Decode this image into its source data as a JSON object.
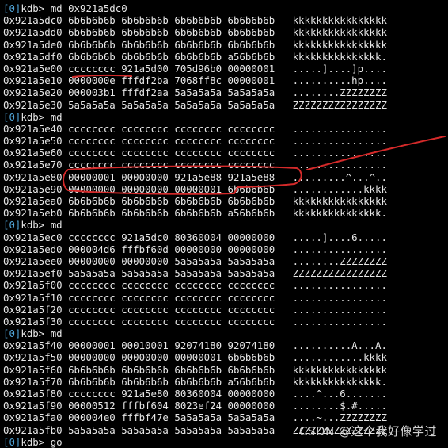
{
  "colors": {
    "background": "#000000",
    "text": "#e6e6e6",
    "prompt_tag": "#4fa3d6",
    "annotation": "#d42a2a"
  },
  "terminal": {
    "lines": [
      {
        "kind": "prompt",
        "tag": "[0]",
        "text": "kdb> md 0x921a5dc0"
      },
      {
        "kind": "dump",
        "addr": "0x921a5dc0",
        "words": "6b6b6b6b 6b6b6b6b 6b6b6b6b 6b6b6b6b",
        "ascii": "kkkkkkkkkkkkkkkk"
      },
      {
        "kind": "dump",
        "addr": "0x921a5dd0",
        "words": "6b6b6b6b 6b6b6b6b 6b6b6b6b 6b6b6b6b",
        "ascii": "kkkkkkkkkkkkkkkk"
      },
      {
        "kind": "dump",
        "addr": "0x921a5de0",
        "words": "6b6b6b6b 6b6b6b6b 6b6b6b6b 6b6b6b6b",
        "ascii": "kkkkkkkkkkkkkkkk"
      },
      {
        "kind": "dump",
        "addr": "0x921a5df0",
        "words": "6b6b6b6b 6b6b6b6b 6b6b6b6b a56b6b6b",
        "ascii": "kkkkkkkkkkkkkkk."
      },
      {
        "kind": "dump",
        "addr": "0x921a5e00",
        "words": "cccccccc 921a5d00 705d96b0 00000001",
        "ascii": ".....]....]p...."
      },
      {
        "kind": "dump",
        "addr": "0x921a5e10",
        "words": "0000000e fffdf2ba 7068ff8c 00000001",
        "ascii": "..........hp...."
      },
      {
        "kind": "dump",
        "addr": "0x921a5e20",
        "words": "000003b1 fffdf2aa 5a5a5a5a 5a5a5a5a",
        "ascii": "........ZZZZZZZZ"
      },
      {
        "kind": "dump",
        "addr": "0x921a5e30",
        "words": "5a5a5a5a 5a5a5a5a 5a5a5a5a 5a5a5a5a",
        "ascii": "ZZZZZZZZZZZZZZZZ"
      },
      {
        "kind": "prompt",
        "tag": "[0]",
        "text": "kdb> md"
      },
      {
        "kind": "dump",
        "addr": "0x921a5e40",
        "words": "cccccccc cccccccc cccccccc cccccccc",
        "ascii": "................"
      },
      {
        "kind": "dump",
        "addr": "0x921a5e50",
        "words": "cccccccc cccccccc cccccccc cccccccc",
        "ascii": "................"
      },
      {
        "kind": "dump",
        "addr": "0x921a5e60",
        "words": "cccccccc cccccccc cccccccc cccccccc",
        "ascii": "................"
      },
      {
        "kind": "dump",
        "addr": "0x921a5e70",
        "words": "cccccccc cccccccc cccccccc cccccccc",
        "ascii": "................"
      },
      {
        "kind": "dump",
        "addr": "0x921a5e80",
        "words": "00000001 00000000 921a5e88 921a5e88",
        "ascii": ".........^...^.."
      },
      {
        "kind": "dump",
        "addr": "0x921a5e90",
        "words": "00000000 00000000 00000001 6b6b6b6b",
        "ascii": "............kkkk"
      },
      {
        "kind": "dump",
        "addr": "0x921a5ea0",
        "words": "6b6b6b6b 6b6b6b6b 6b6b6b6b 6b6b6b6b",
        "ascii": "kkkkkkkkkkkkkkkk"
      },
      {
        "kind": "dump",
        "addr": "0x921a5eb0",
        "words": "6b6b6b6b 6b6b6b6b 6b6b6b6b a56b6b6b",
        "ascii": "kkkkkkkkkkkkkkk."
      },
      {
        "kind": "prompt",
        "tag": "[0]",
        "text": "kdb> md"
      },
      {
        "kind": "dump",
        "addr": "0x921a5ec0",
        "words": "cccccccc 921a5dc0 80360004 00000000",
        "ascii": ".....]....6....."
      },
      {
        "kind": "dump",
        "addr": "0x921a5ed0",
        "words": "000004d6 fffbf60d 00000000 00000000",
        "ascii": "................"
      },
      {
        "kind": "dump",
        "addr": "0x921a5ee0",
        "words": "00000000 00000000 5a5a5a5a 5a5a5a5a",
        "ascii": "........ZZZZZZZZ"
      },
      {
        "kind": "dump",
        "addr": "0x921a5ef0",
        "words": "5a5a5a5a 5a5a5a5a 5a5a5a5a 5a5a5a5a",
        "ascii": "ZZZZZZZZZZZZZZZZ"
      },
      {
        "kind": "dump",
        "addr": "0x921a5f00",
        "words": "cccccccc cccccccc cccccccc cccccccc",
        "ascii": "................"
      },
      {
        "kind": "dump",
        "addr": "0x921a5f10",
        "words": "cccccccc cccccccc cccccccc cccccccc",
        "ascii": "................"
      },
      {
        "kind": "dump",
        "addr": "0x921a5f20",
        "words": "cccccccc cccccccc cccccccc cccccccc",
        "ascii": "................"
      },
      {
        "kind": "dump",
        "addr": "0x921a5f30",
        "words": "cccccccc cccccccc cccccccc cccccccc",
        "ascii": "................"
      },
      {
        "kind": "prompt",
        "tag": "[0]",
        "text": "kdb> md"
      },
      {
        "kind": "dump",
        "addr": "0x921a5f40",
        "words": "00000001 00010001 92074180 92074180",
        "ascii": "..........A...A."
      },
      {
        "kind": "dump",
        "addr": "0x921a5f50",
        "words": "00000000 00000000 00000001 6b6b6b6b",
        "ascii": "............kkkk"
      },
      {
        "kind": "dump",
        "addr": "0x921a5f60",
        "words": "6b6b6b6b 6b6b6b6b 6b6b6b6b 6b6b6b6b",
        "ascii": "kkkkkkkkkkkkkkkk"
      },
      {
        "kind": "dump",
        "addr": "0x921a5f70",
        "words": "6b6b6b6b 6b6b6b6b 6b6b6b6b a56b6b6b",
        "ascii": "kkkkkkkkkkkkkkk."
      },
      {
        "kind": "dump",
        "addr": "0x921a5f80",
        "words": "cccccccc 921a5e80 80360004 00000000",
        "ascii": "....^...6......."
      },
      {
        "kind": "dump",
        "addr": "0x921a5f90",
        "words": "00000512 fffbf604 8023ef24 00000000",
        "ascii": "........$.#....."
      },
      {
        "kind": "dump",
        "addr": "0x921a5fa0",
        "words": "000004e0 fffbf47e 5a5a5a5a 5a5a5a5a",
        "ascii": "....~...ZZZZZZZZ"
      },
      {
        "kind": "dump",
        "addr": "0x921a5fb0",
        "words": "5a5a5a5a 5a5a5a5a 5a5a5a5a 5a5a5a5a",
        "ascii": "ZZZZZZZZZZZZZZZZ"
      },
      {
        "kind": "prompt",
        "tag": "[0]",
        "text": "kdb> go"
      }
    ]
  },
  "watermark": {
    "text": "CSDN @这个我好像学过"
  }
}
